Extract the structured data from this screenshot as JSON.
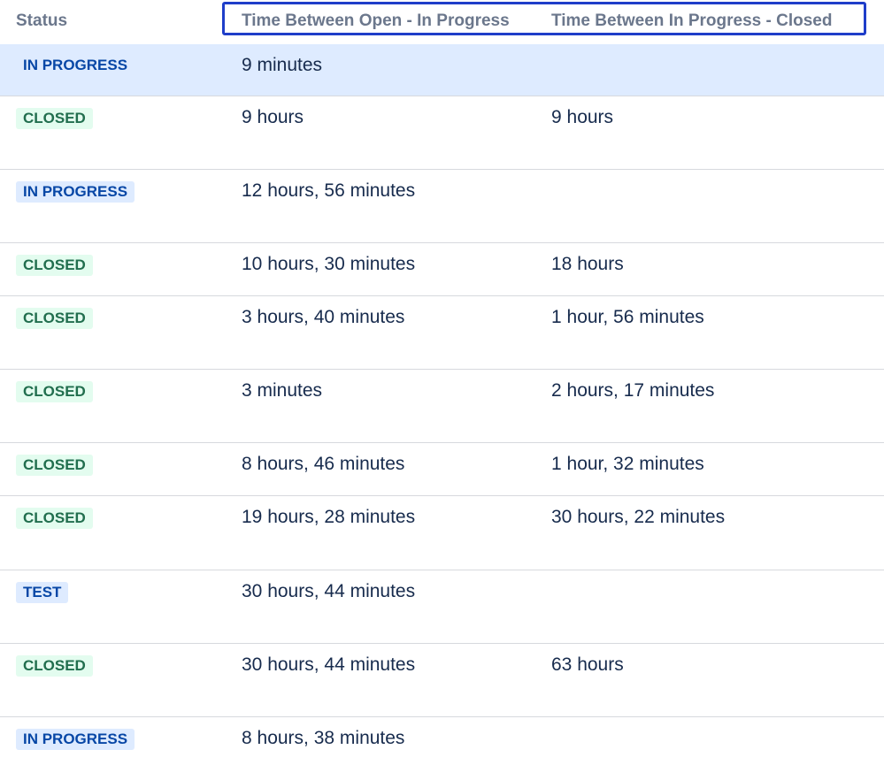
{
  "columns": {
    "status": "Status",
    "col1": "Time Between Open - In Progress",
    "col2": "Time Between In Progress - Closed"
  },
  "rows": [
    {
      "status": "IN PROGRESS",
      "kind": "progress",
      "c1": "9 minutes",
      "c2": "",
      "selected": true
    },
    {
      "status": "CLOSED",
      "kind": "closed",
      "c1": "9 hours",
      "c2": "9 hours"
    },
    {
      "status": "IN PROGRESS",
      "kind": "progress",
      "c1": "12 hours, 56 minutes",
      "c2": ""
    },
    {
      "status": "CLOSED",
      "kind": "closed",
      "c1": "10 hours, 30 minutes",
      "c2": "18 hours"
    },
    {
      "status": "CLOSED",
      "kind": "closed",
      "c1": "3 hours, 40 minutes",
      "c2": "1 hour, 56 minutes"
    },
    {
      "status": "CLOSED",
      "kind": "closed",
      "c1": "3 minutes",
      "c2": "2 hours, 17 minutes"
    },
    {
      "status": "CLOSED",
      "kind": "closed",
      "c1": "8 hours, 46 minutes",
      "c2": "1 hour, 32 minutes"
    },
    {
      "status": "CLOSED",
      "kind": "closed",
      "c1": "19 hours, 28 minutes",
      "c2": "30 hours, 22 minutes"
    },
    {
      "status": "TEST",
      "kind": "progress",
      "c1": "30 hours, 44 minutes",
      "c2": ""
    },
    {
      "status": "CLOSED",
      "kind": "closed",
      "c1": "30 hours, 44 minutes",
      "c2": "63 hours"
    },
    {
      "status": "IN PROGRESS",
      "kind": "progress",
      "c1": "8 hours, 38 minutes",
      "c2": ""
    }
  ]
}
